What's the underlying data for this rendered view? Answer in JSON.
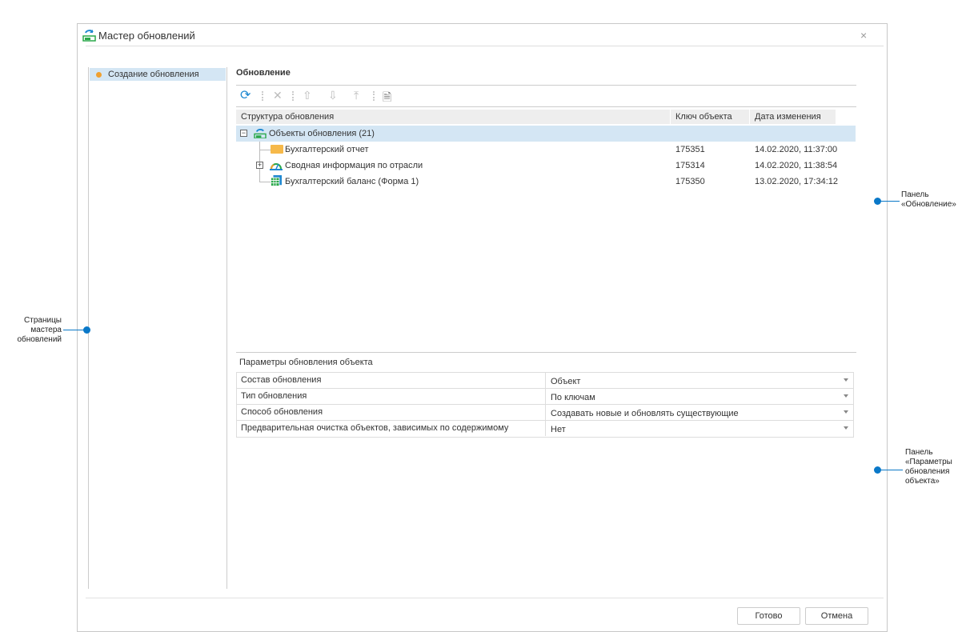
{
  "window": {
    "title": "Мастер обновлений",
    "close_icon": "close-icon"
  },
  "sidebar": {
    "items": [
      {
        "label": "Создание обновления",
        "selected": true,
        "status_color": "#f0a030"
      }
    ]
  },
  "panel": {
    "title": "Обновление",
    "toolbar": [
      "refresh-icon",
      "delete-icon",
      "move-up-icon",
      "move-down-icon",
      "move-top-icon",
      "export-icon"
    ],
    "columns": [
      "Структура обновления",
      "Ключ объекта",
      "Дата изменения"
    ],
    "rows": [
      {
        "name": "Объекты обновления (21)",
        "key": "",
        "date": "",
        "type": "root",
        "expanded": true,
        "selected": true
      },
      {
        "name": "Бухгалтерский отчет",
        "key": "175351",
        "date": "14.02.2020, 11:37:00",
        "type": "folder"
      },
      {
        "name": "Сводная информация по отрасли",
        "key": "175314",
        "date": "14.02.2020, 11:38:54",
        "type": "dashboard",
        "expandable": true
      },
      {
        "name": "Бухгалтерский баланс (Форма 1)",
        "key": "175350",
        "date": "13.02.2020, 17:34:12",
        "type": "table"
      }
    ]
  },
  "params": {
    "title": "Параметры обновления объекта",
    "rows": [
      {
        "name": "Состав обновления",
        "value": "Объект"
      },
      {
        "name": "Тип обновления",
        "value": "По ключам"
      },
      {
        "name": "Способ обновления",
        "value": "Создавать новые и обновлять существующие"
      },
      {
        "name": "Предварительная очистка объектов, зависимых по содержимому",
        "value": "Нет"
      }
    ]
  },
  "footer": {
    "done": "Готово",
    "cancel": "Отмена"
  },
  "annotations": {
    "pages": [
      "Страницы",
      "мастера",
      "обновлений"
    ],
    "update_panel": [
      "Панель",
      "«Обновление»"
    ],
    "params_panel": [
      "Панель",
      "«Параметры",
      "обновления",
      "объекта»"
    ]
  },
  "colors": {
    "accent": "#0a78c8",
    "selection": "#d4e6f4"
  }
}
